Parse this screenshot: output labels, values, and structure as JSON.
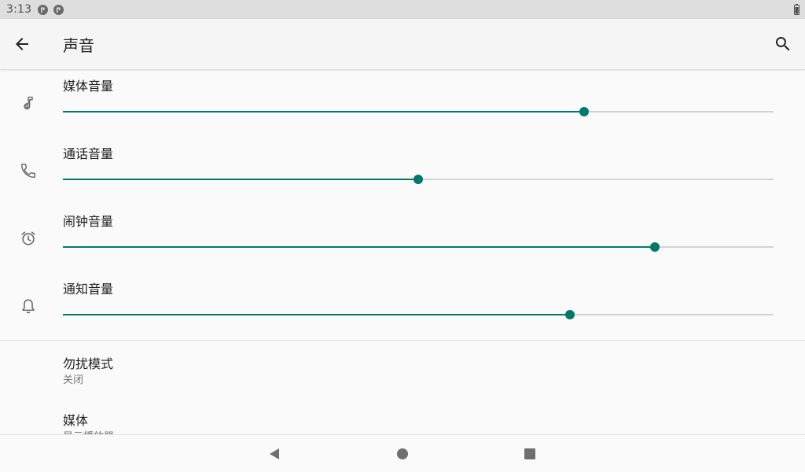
{
  "status_bar": {
    "time": "3:13",
    "notification_icons": [
      "notification-icon",
      "notification-icon"
    ],
    "battery_icon": "battery-icon"
  },
  "app_bar": {
    "title": "声音",
    "back_icon": "arrow-back-icon",
    "search_icon": "search-icon"
  },
  "volume_sliders": [
    {
      "label": "媒体音量",
      "icon": "music-note-icon",
      "level": 0.733
    },
    {
      "label": "通话音量",
      "icon": "phone-icon",
      "level": 0.5
    },
    {
      "label": "闹钟音量",
      "icon": "alarm-icon",
      "level": 0.833
    },
    {
      "label": "通知音量",
      "icon": "bell-icon",
      "level": 0.714
    }
  ],
  "preferences": [
    {
      "title": "勿扰模式",
      "summary": "关闭"
    },
    {
      "title": "媒体",
      "summary": "显示播放器"
    }
  ],
  "navigation_bar": {
    "buttons": [
      "back-triangle-icon",
      "home-circle-icon",
      "recents-square-icon"
    ]
  },
  "colors": {
    "accent": "#00796b",
    "track_inactive": "#d3d3d3",
    "status_bar_bg": "#dedede",
    "app_bar_bg": "#f5f5f5",
    "background": "#fafafa"
  }
}
